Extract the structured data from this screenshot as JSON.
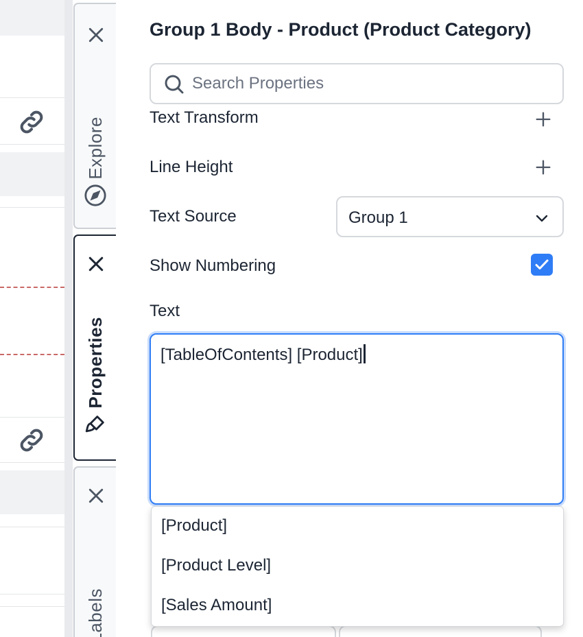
{
  "panel": {
    "title": "Group 1 Body - Product (Product Category)",
    "search": {
      "placeholder": "Search Properties",
      "value": ""
    },
    "properties": {
      "text_transform": {
        "label": "Text Transform"
      },
      "line_height": {
        "label": "Line Height"
      },
      "text_source": {
        "label": "Text Source",
        "value": "Group 1"
      },
      "show_numbering": {
        "label": "Show Numbering",
        "checked": true
      },
      "text": {
        "label": "Text",
        "value": "[TableOfContents] [Product]"
      }
    },
    "autocomplete": {
      "options": [
        "[Product]",
        "[Product Level]",
        "[Sales Amount]"
      ]
    }
  },
  "tabs": {
    "explore": {
      "label": "Explore"
    },
    "properties": {
      "label": "Properties"
    },
    "labels": {
      "label": "Labels"
    }
  },
  "colors": {
    "accent": "#2f7df6",
    "text": "#1c2533",
    "border": "#d5d8dc",
    "dashed_line": "#c0504d"
  }
}
